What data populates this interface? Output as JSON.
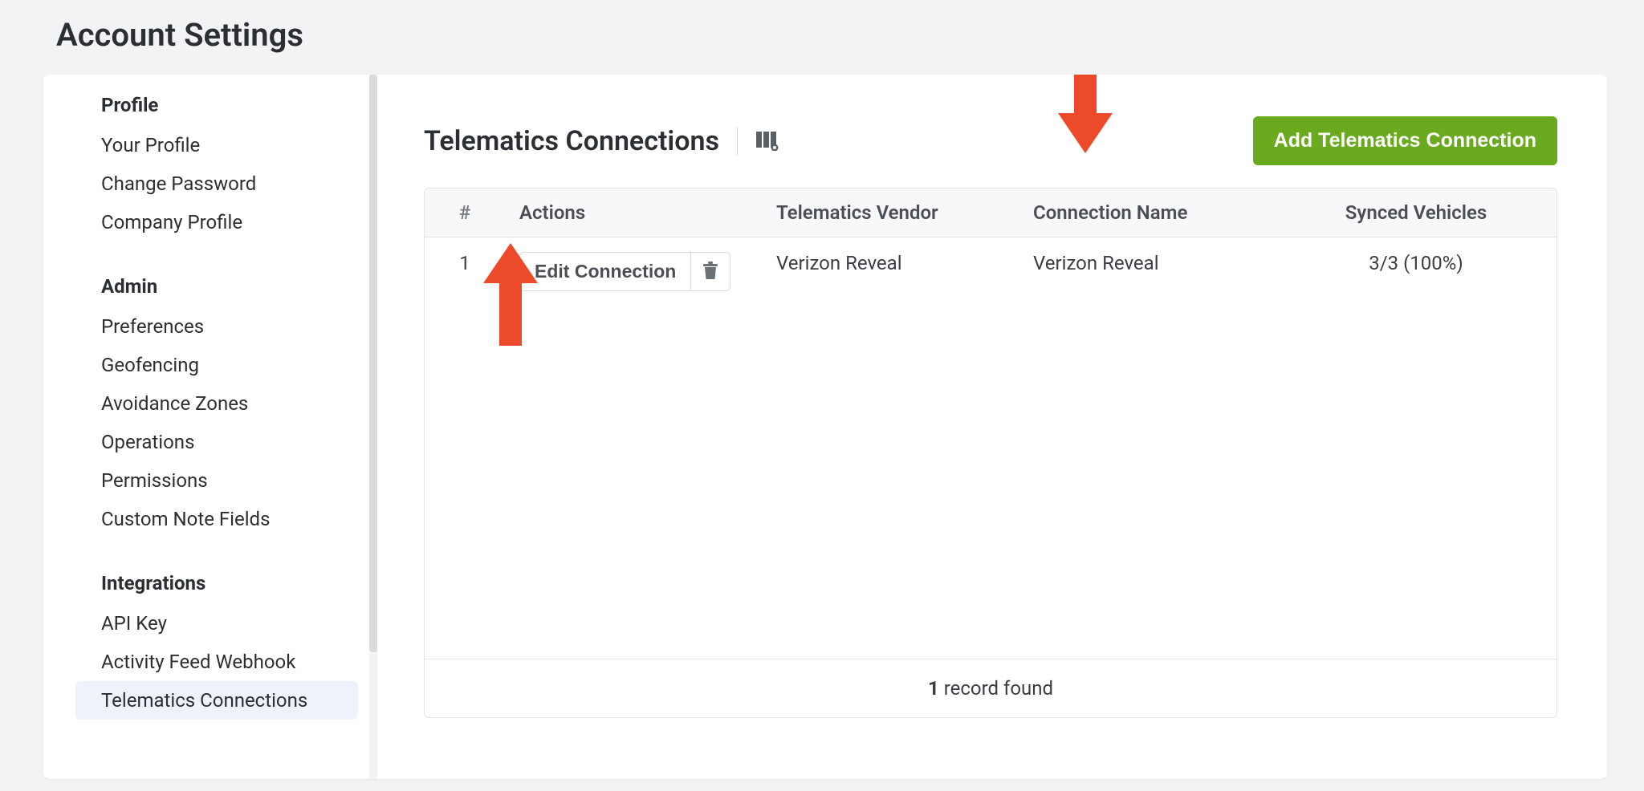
{
  "page": {
    "title": "Account Settings"
  },
  "sidebar": {
    "sections": [
      {
        "heading": "Profile",
        "items": [
          {
            "label": "Your Profile",
            "active": false
          },
          {
            "label": "Change Password",
            "active": false
          },
          {
            "label": "Company Profile",
            "active": false
          }
        ]
      },
      {
        "heading": "Admin",
        "items": [
          {
            "label": "Preferences",
            "active": false
          },
          {
            "label": "Geofencing",
            "active": false
          },
          {
            "label": "Avoidance Zones",
            "active": false
          },
          {
            "label": "Operations",
            "active": false
          },
          {
            "label": "Permissions",
            "active": false
          },
          {
            "label": "Custom Note Fields",
            "active": false
          }
        ]
      },
      {
        "heading": "Integrations",
        "items": [
          {
            "label": "API Key",
            "active": false
          },
          {
            "label": "Activity Feed Webhook",
            "active": false
          },
          {
            "label": "Telematics Connections",
            "active": true
          }
        ]
      }
    ]
  },
  "main": {
    "title": "Telematics Connections",
    "add_button_label": "Add Telematics Connection",
    "table": {
      "headers": {
        "num": "#",
        "actions": "Actions",
        "vendor": "Telematics Vendor",
        "name": "Connection Name",
        "synced": "Synced Vehicles"
      },
      "rows": [
        {
          "num": "1",
          "edit_label": "Edit Connection",
          "vendor": "Verizon Reveal",
          "name": "Verizon Reveal",
          "synced": "3/3 (100%)"
        }
      ],
      "footer_count": "1",
      "footer_text": " record found"
    }
  },
  "annotations": {
    "arrow_color": "#ec4a2a"
  }
}
